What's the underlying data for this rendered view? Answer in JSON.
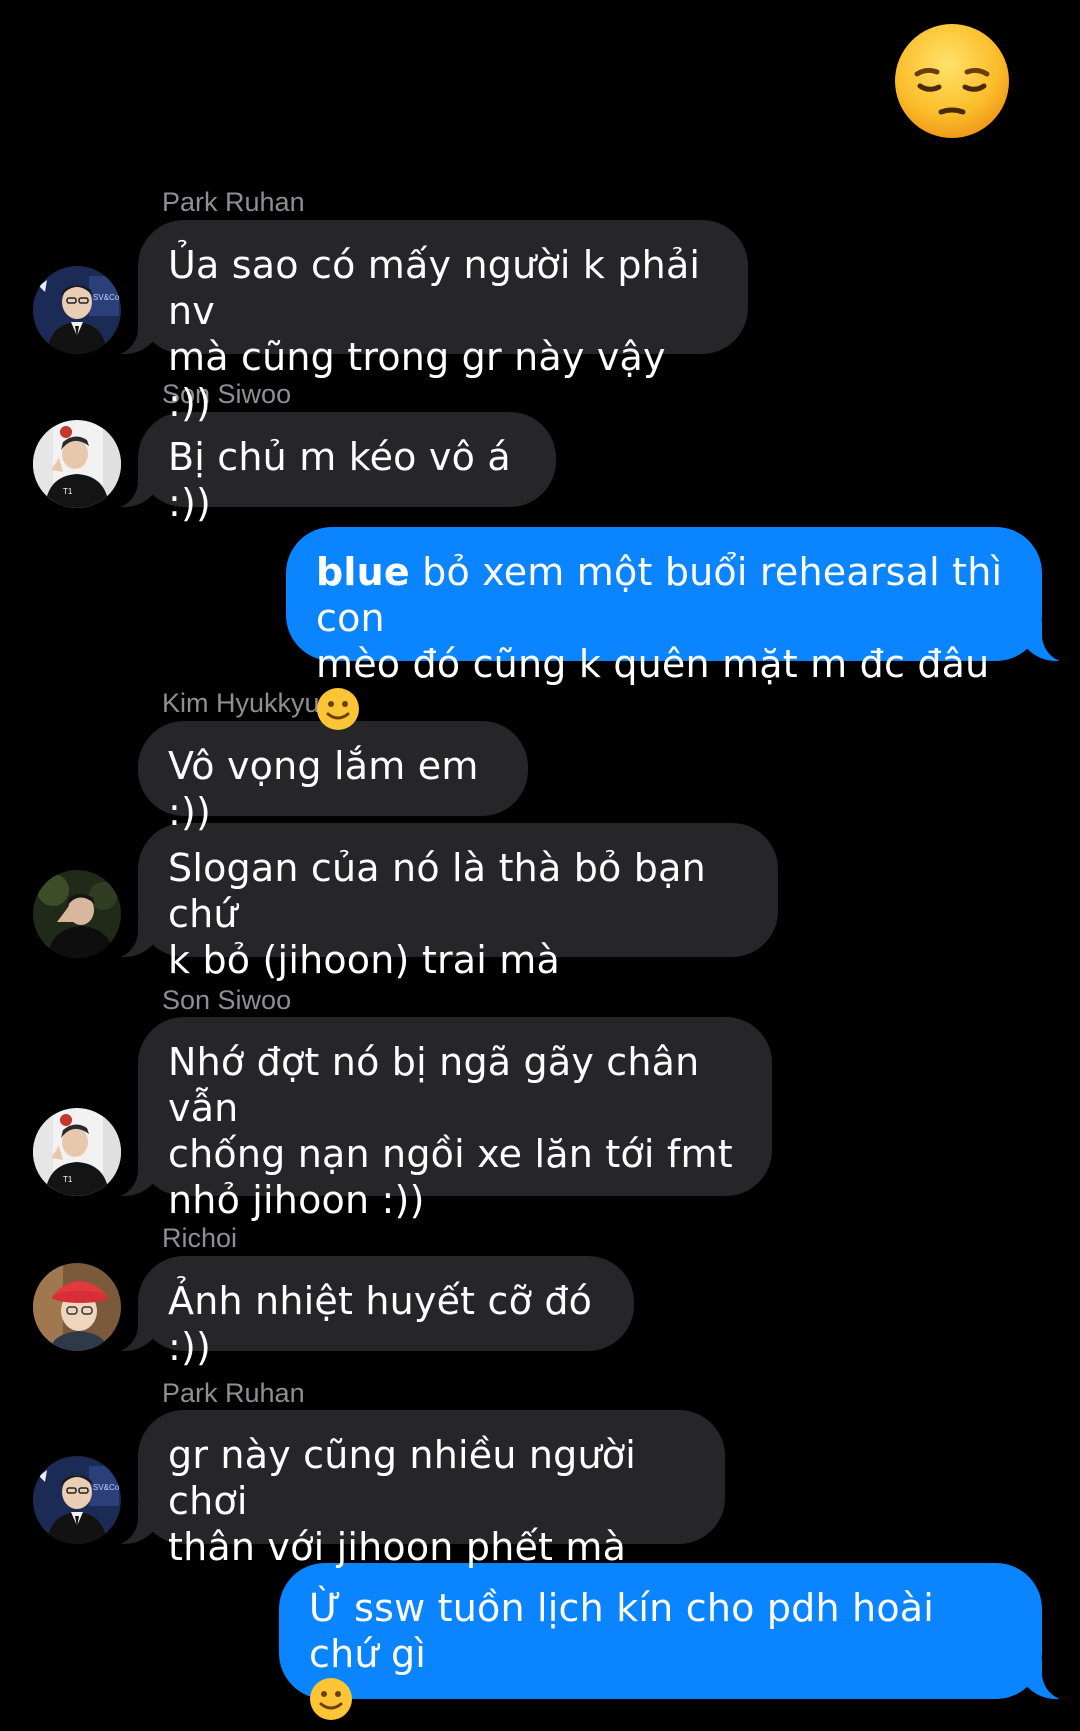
{
  "reaction": {
    "icon": "pensive-face-emoji"
  },
  "messages": [
    {
      "sender": "Park Ruhan",
      "lines": [
        "Ủa sao có mấy người k phải nv",
        "mà cũng trong gr này vậy :))"
      ]
    },
    {
      "sender": "Son Siwoo",
      "lines": [
        "Bị chủ m kéo vô á :))"
      ]
    },
    {
      "sender": "me",
      "mention": "blue",
      "lines": [
        " bỏ xem một buổi rehearsal thì con",
        "mèo đó cũng k quên mặt m đc đâu "
      ]
    },
    {
      "sender": "Kim Hyukkyu",
      "lines": [
        "Vô vọng lắm em :))"
      ]
    },
    {
      "sender": "Kim Hyukkyu",
      "lines": [
        "Slogan của nó là thà bỏ bạn chứ",
        "k bỏ (jihoon) trai mà"
      ]
    },
    {
      "sender": "Son Siwoo",
      "lines": [
        "Nhớ đợt nó bị ngã gãy chân vẫn",
        "chống nạn ngồi xe lăn tới fmt",
        "nhỏ jihoon :))"
      ]
    },
    {
      "sender": "Richoi",
      "lines": [
        "Ảnh nhiệt huyết cỡ đó :))"
      ]
    },
    {
      "sender": "Park Ruhan",
      "lines": [
        "gr này cũng nhiều người chơi",
        "thân với jihoon phết mà"
      ]
    },
    {
      "sender": "me",
      "lines": [
        "Ừ ssw tuồn lịch kín cho pdh hoài chứ gì",
        ""
      ]
    }
  ],
  "colors": {
    "incoming": "#262628",
    "outgoing": "#0a84ff",
    "sender_name": "#8e8e93"
  }
}
